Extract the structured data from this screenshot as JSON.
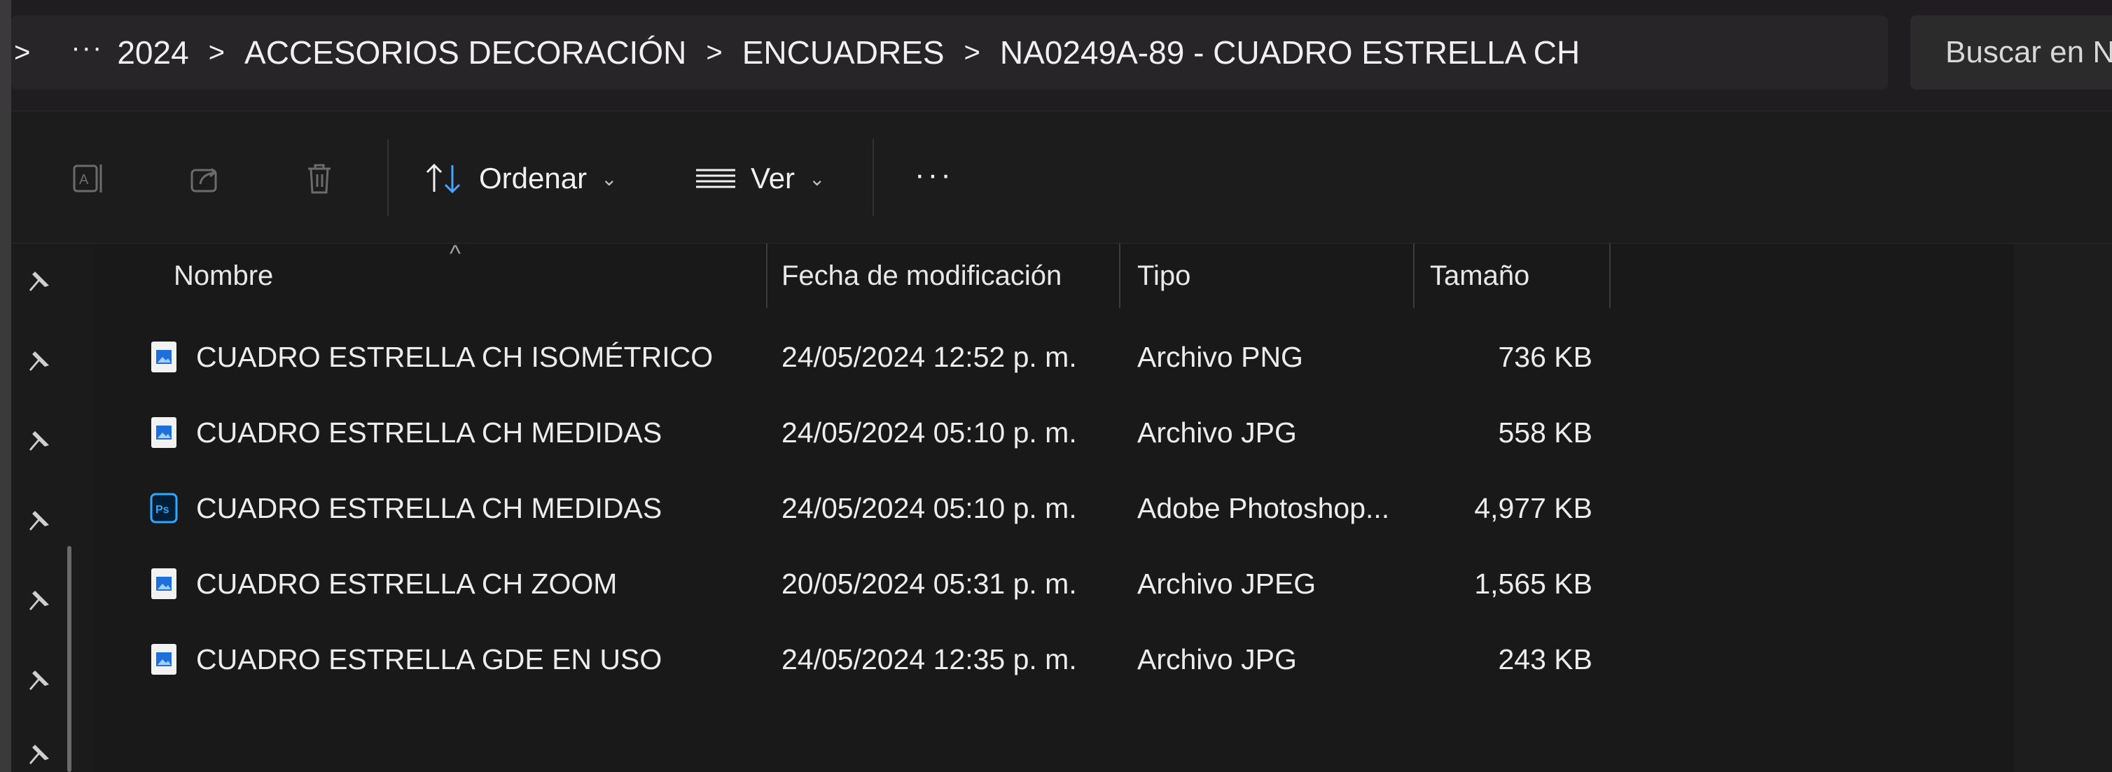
{
  "address_bar": {
    "leading_arrow": ">",
    "overflow": "···",
    "separator": ">",
    "crumbs": [
      "2024",
      "ACCESORIOS DECORACIÓN",
      "ENCUADRES",
      "NA0249A-89 - CUADRO ESTRELLA CH"
    ]
  },
  "search": {
    "placeholder": "Buscar en N"
  },
  "toolbar": {
    "sort_label": "Ordenar",
    "view_label": "Ver",
    "more_label": "···",
    "icons": [
      "rename-icon",
      "share-icon",
      "delete-icon",
      "sort-icon",
      "view-icon"
    ]
  },
  "columns": {
    "name": "Nombre",
    "date": "Fecha de modificación",
    "type": "Tipo",
    "size": "Tamaño",
    "sort_indicator": "^"
  },
  "files": [
    {
      "name": "CUADRO ESTRELLA CH ISOMÉTRICO",
      "date": "24/05/2024 12:52 p. m.",
      "type": "Archivo PNG",
      "size": "736 KB",
      "icon": "image-file-icon"
    },
    {
      "name": "CUADRO ESTRELLA CH MEDIDAS",
      "date": "24/05/2024 05:10 p. m.",
      "type": "Archivo JPG",
      "size": "558 KB",
      "icon": "image-file-icon"
    },
    {
      "name": "CUADRO ESTRELLA CH MEDIDAS",
      "date": "24/05/2024 05:10 p. m.",
      "type": "Adobe Photoshop...",
      "size": "4,977 KB",
      "icon": "photoshop-file-icon"
    },
    {
      "name": "CUADRO ESTRELLA CH ZOOM",
      "date": "20/05/2024 05:31 p. m.",
      "type": "Archivo JPEG",
      "size": "1,565 KB",
      "icon": "image-file-icon"
    },
    {
      "name": "CUADRO ESTRELLA GDE EN USO",
      "date": "24/05/2024 12:35 p. m.",
      "type": "Archivo JPG",
      "size": "243 KB",
      "icon": "image-file-icon"
    }
  ],
  "colors": {
    "background": "#191919",
    "address_bar": "#272528",
    "text": "#ececec",
    "image_icon_accent": "#1e6fd9",
    "photoshop_icon_accent": "#31a8ff"
  }
}
